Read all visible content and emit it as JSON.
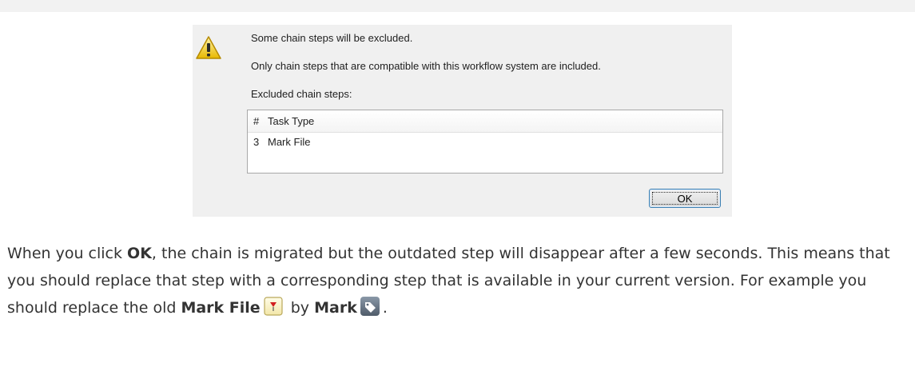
{
  "dialog": {
    "message_line1": "Some chain steps will be excluded.",
    "message_line2": "Only chain steps that are compatible with this workflow system are included.",
    "excluded_label": "Excluded chain steps:",
    "table": {
      "headers": [
        "#",
        "Task Type"
      ],
      "rows": [
        {
          "num": "3",
          "type": "Mark File"
        }
      ]
    },
    "ok_label": "OK",
    "warning_icon": "warning-icon"
  },
  "body": {
    "seg1": "When you click ",
    "seg1_bold": "OK",
    "seg2": ", the chain is migrated but the outdated step will disappear after a few seconds. This means that you should replace that step with a corresponding step that is available in your current version. For example you should replace the old ",
    "mark_file_bold": "Mark File",
    "seg3": " by ",
    "mark_bold": "Mark",
    "seg4": ".",
    "mark_file_icon": "mark-file-icon",
    "mark_icon": "tag-icon"
  },
  "colors": {
    "dialog_bg": "#f0f0f0",
    "warning_yellow": "#f5d33a",
    "ok_border": "#3c7fb1"
  }
}
